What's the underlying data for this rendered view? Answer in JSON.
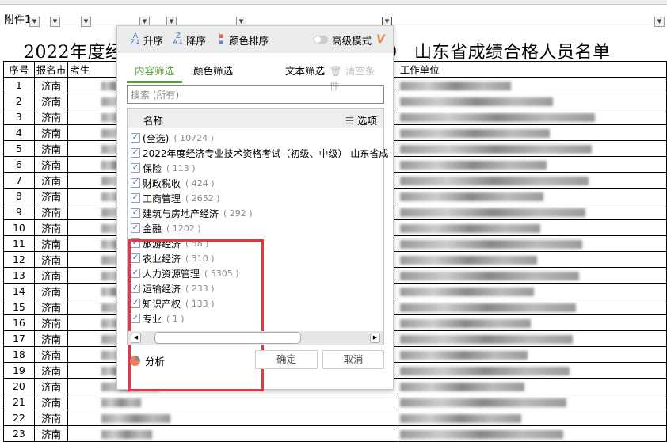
{
  "sheet": {
    "filter_label": "附件1",
    "title": "2022年度经济专业技术资格考试（初级、中级） 山东省成绩合格人员名单",
    "headers": {
      "seq": "序号",
      "city": "报名市",
      "examinee": "考生",
      "unit": "工作单位"
    },
    "rows": [
      {
        "seq": "1",
        "city": "济南"
      },
      {
        "seq": "2",
        "city": "济南"
      },
      {
        "seq": "3",
        "city": "济南"
      },
      {
        "seq": "4",
        "city": "济南"
      },
      {
        "seq": "5",
        "city": "济南"
      },
      {
        "seq": "6",
        "city": "济南"
      },
      {
        "seq": "7",
        "city": "济南"
      },
      {
        "seq": "8",
        "city": "济南"
      },
      {
        "seq": "9",
        "city": "济南"
      },
      {
        "seq": "10",
        "city": "济南"
      },
      {
        "seq": "11",
        "city": "济南"
      },
      {
        "seq": "12",
        "city": "济南"
      },
      {
        "seq": "13",
        "city": "济南"
      },
      {
        "seq": "14",
        "city": "济南"
      },
      {
        "seq": "15",
        "city": "济南"
      },
      {
        "seq": "16",
        "city": "济南"
      },
      {
        "seq": "17",
        "city": "济南"
      },
      {
        "seq": "18",
        "city": "济南"
      },
      {
        "seq": "19",
        "city": "济南"
      },
      {
        "seq": "20",
        "city": "济南"
      },
      {
        "seq": "21",
        "city": "济南"
      },
      {
        "seq": "22",
        "city": "济南"
      },
      {
        "seq": "23",
        "city": "济南"
      }
    ]
  },
  "filter_popup": {
    "toolbar": {
      "asc": "升序",
      "desc": "降序",
      "color_sort": "颜色排序",
      "advanced": "高级模式",
      "vip": "V"
    },
    "tabs": {
      "content": "内容筛选",
      "color": "颜色筛选",
      "text": "文本筛选",
      "clear": "清空条件"
    },
    "search_placeholder": "搜索 (所有)",
    "list_header": {
      "name": "名称",
      "options": "选项"
    },
    "items": [
      {
        "label": "(全选)",
        "count": "( 10724 )"
      },
      {
        "label": "2022年度经济专业技术资格考试（初级、中级） 山东省成",
        "count": ""
      },
      {
        "label": "保险",
        "count": "( 113 )"
      },
      {
        "label": "财政税收",
        "count": "( 424 )"
      },
      {
        "label": "工商管理",
        "count": "( 2652 )"
      },
      {
        "label": "建筑与房地产经济",
        "count": "( 292 )"
      },
      {
        "label": "金融",
        "count": "( 1202 )"
      },
      {
        "label": "旅游经济",
        "count": "( 58 )"
      },
      {
        "label": "农业经济",
        "count": "( 310 )"
      },
      {
        "label": "人力资源管理",
        "count": "( 5305 )"
      },
      {
        "label": "运输经济",
        "count": "( 233 )"
      },
      {
        "label": "知识产权",
        "count": "( 133 )"
      },
      {
        "label": "专业",
        "count": "( 1 )"
      }
    ],
    "analysis": "分析",
    "ok": "确定",
    "cancel": "取消",
    "colors": {
      "accent": "#5c9b3a",
      "highlight": "#e0393e"
    }
  }
}
